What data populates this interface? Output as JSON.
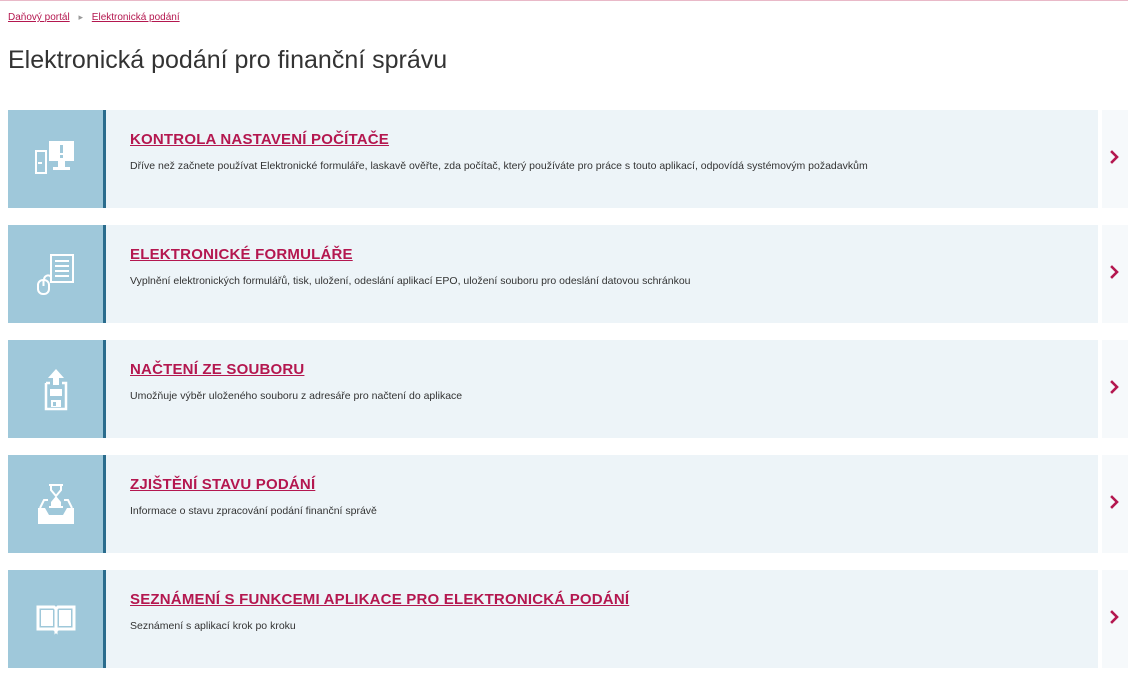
{
  "breadcrumb": {
    "items": [
      "Daňový portál",
      "Elektronická podání"
    ]
  },
  "page": {
    "title": "Elektronická podání pro finanční správu"
  },
  "tiles": [
    {
      "icon": "computer-check-icon",
      "title": "KONTROLA NASTAVENÍ POČÍTAČE",
      "description": "Dříve než začnete používat Elektronické formuláře, laskavě ověřte, zda počítač, který používáte pro práce s touto aplikací, odpovídá systémovým požadavkům"
    },
    {
      "icon": "form-mouse-icon",
      "title": "ELEKTRONICKÉ FORMULÁŘE",
      "description": "Vyplnění elektronických formulářů, tisk, uložení, odeslání aplikací EPO, uložení souboru pro odeslání datovou schránkou"
    },
    {
      "icon": "upload-file-icon",
      "title": "NAČTENÍ ZE SOUBORU",
      "description": "Umožňuje výběr uloženého souboru z adresáře pro načtení do aplikace"
    },
    {
      "icon": "hourglass-inbox-icon",
      "title": "ZJIŠTĚNÍ STAVU PODÁNÍ",
      "description": "Informace o stavu zpracování podání finanční správě"
    },
    {
      "icon": "open-book-icon",
      "title": "SEZNÁMENÍ S FUNKCEMI APLIKACE PRO ELEKTRONICKÁ PODÁNÍ",
      "description": "Seznámení s aplikací krok po kroku"
    }
  ],
  "colors": {
    "accent": "#b4174f",
    "icon_panel": "#9fc8da",
    "tile_background": "#edf4f8",
    "divider": "#2a6c8d"
  }
}
